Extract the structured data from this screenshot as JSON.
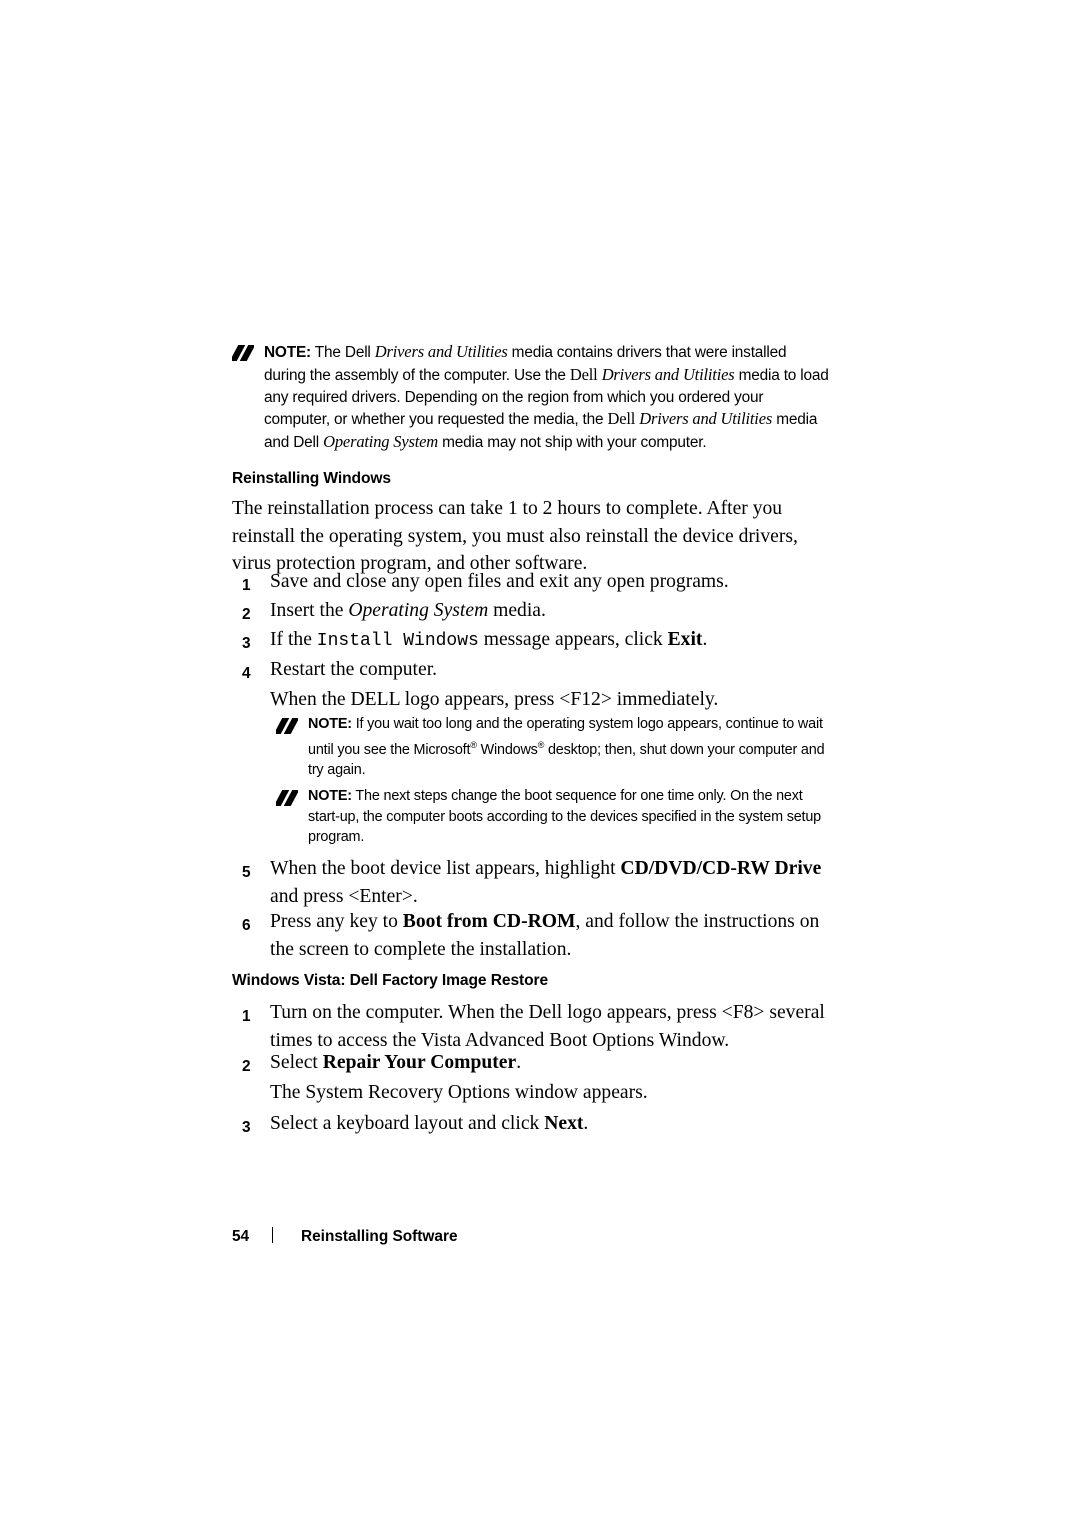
{
  "notes": {
    "note1": {
      "label": "NOTE:",
      "text_runs": [
        {
          "t": "The Dell ",
          "s": "plain"
        },
        {
          "t": "Drivers and Utilities",
          "s": "italic"
        },
        {
          "t": " media contains drivers that were installed during the assembly of the computer. Use the ",
          "s": "plain"
        },
        {
          "t": "Dell ",
          "s": "serif"
        },
        {
          "t": "Drivers and Utilities",
          "s": "italic"
        },
        {
          "t": " media to load any required drivers. Depending on the region from which you ordered your computer, or whether you requested the media, the ",
          "s": "plain"
        },
        {
          "t": "Dell ",
          "s": "serif"
        },
        {
          "t": "Drivers and Utilities",
          "s": "italic"
        },
        {
          "t": " media and Dell ",
          "s": "serif"
        },
        {
          "t": "Operating System",
          "s": "italic"
        },
        {
          "t": " media may not ship with your computer.",
          "s": "plain"
        }
      ]
    },
    "note2": {
      "label": "NOTE:",
      "text": "If you wait too long and the operating system logo appears, continue to wait until you see the Microsoft® Windows® desktop; then, shut down your computer and try again."
    },
    "note3": {
      "label": "NOTE:",
      "text": "The next steps change the boot sequence for one time only. On the next start-up, the computer boots according to the devices specified in the system setup program."
    }
  },
  "headings": {
    "reinstalling_windows": "Reinstalling Windows",
    "vista_factory_restore": "Windows Vista: Dell Factory Image Restore"
  },
  "paragraphs": {
    "intro": "The reinstallation process can take 1 to 2 hours to complete. After you reinstall the operating system, you must also reinstall the device drivers, virus protection program, and other software."
  },
  "steps_windows": [
    {
      "num": "1",
      "text": "Save and close any open files and exit any open programs."
    },
    {
      "num": "2",
      "text": "Insert the Operating System media.",
      "italic_part": "Operating System"
    },
    {
      "num": "3",
      "text": "If the Install Windows message appears, click Exit.",
      "mono_part": "Install Windows",
      "bold_part": "Exit"
    },
    {
      "num": "4",
      "text": "Restart the computer."
    },
    {
      "num": "5",
      "text": "When the boot device list appears, highlight CD/DVD/CD-RW Drive and press <Enter>.",
      "bold_part": "CD/DVD/CD-RW Drive"
    },
    {
      "num": "6",
      "text": "Press any key to Boot from CD-ROM, and follow the instructions on the screen to complete the installation.",
      "bold_part": "Boot from CD-ROM"
    }
  ],
  "continuations": {
    "after_step4": "When the DELL logo appears, press <F12> immediately."
  },
  "steps_vista": [
    {
      "num": "1",
      "text": "Turn on the computer. When the Dell logo appears, press <F8> several times to access the Vista Advanced Boot Options Window."
    },
    {
      "num": "2",
      "text": "Select Repair Your Computer.",
      "bold_part": "Repair Your Computer"
    },
    {
      "num": "3",
      "text": "Select a keyboard layout and click Next.",
      "bold_part": "Next"
    }
  ],
  "continuations_vista": {
    "after_step2": "The System Recovery Options window appears."
  },
  "footer": {
    "page_number": "54",
    "section_title": "Reinstalling Software"
  }
}
